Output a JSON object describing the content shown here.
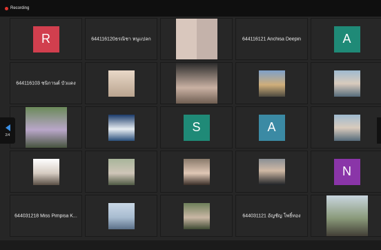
{
  "recording": {
    "label": "Recording",
    "color": "#e0362e"
  },
  "navigation": {
    "page_indicator": "2/4",
    "left_arrow_icon": "chevron-left-icon"
  },
  "participants": [
    {
      "type": "avatar",
      "letter": "R",
      "color": "#d13f4e"
    },
    {
      "type": "name",
      "name": "644116120ธรณิชา หนูแปลก"
    },
    {
      "type": "photo",
      "photo": "two-portraits"
    },
    {
      "type": "name",
      "name": "644116121 Anchisa Deepin"
    },
    {
      "type": "avatar",
      "letter": "A",
      "color": "#1f8a77"
    },
    {
      "type": "name",
      "name": "644116103 ชนิกานต์ บัวแดง"
    },
    {
      "type": "photo",
      "photo": "person-indoor"
    },
    {
      "type": "photo",
      "photo": "person-closeup"
    },
    {
      "type": "photo",
      "photo": "person-temple"
    },
    {
      "type": "photo",
      "photo": "person-outdoor"
    },
    {
      "type": "photo",
      "photo": "person-garden"
    },
    {
      "type": "photo",
      "photo": "cartoon-white"
    },
    {
      "type": "avatar",
      "letter": "S",
      "color": "#1f8a77"
    },
    {
      "type": "avatar",
      "letter": "A",
      "color": "#3b8aa4"
    },
    {
      "type": "photo",
      "photo": "person-outdoor"
    },
    {
      "type": "photo",
      "photo": "person-sitting"
    },
    {
      "type": "photo",
      "photo": "person-plants"
    },
    {
      "type": "photo",
      "photo": "person-selfie"
    },
    {
      "type": "photo",
      "photo": "person-dark"
    },
    {
      "type": "avatar",
      "letter": "N",
      "color": "#8a35a8"
    },
    {
      "type": "name",
      "name": "644031218 Miss Pimpisa K..."
    },
    {
      "type": "photo",
      "photo": "person-sea"
    },
    {
      "type": "photo",
      "photo": "person-park"
    },
    {
      "type": "name",
      "name": "644031121 อัญชัญ โพธิ์ทอง"
    },
    {
      "type": "photo",
      "photo": "person-tree"
    }
  ]
}
